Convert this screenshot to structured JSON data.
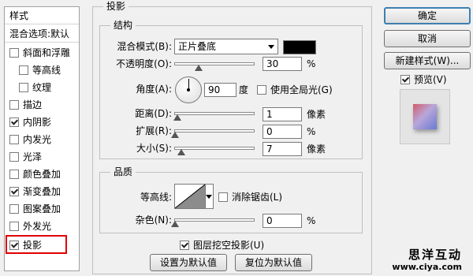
{
  "sidebar": {
    "header": "样式",
    "blend_options": "混合选项:默认",
    "items": [
      {
        "label": "斜面和浮雕",
        "checked": false,
        "sub": false
      },
      {
        "label": "等高线",
        "checked": false,
        "sub": true
      },
      {
        "label": "纹理",
        "checked": false,
        "sub": true
      },
      {
        "label": "描边",
        "checked": false,
        "sub": false
      },
      {
        "label": "内阴影",
        "checked": true,
        "sub": false
      },
      {
        "label": "内发光",
        "checked": false,
        "sub": false
      },
      {
        "label": "光泽",
        "checked": false,
        "sub": false
      },
      {
        "label": "颜色叠加",
        "checked": false,
        "sub": false
      },
      {
        "label": "渐变叠加",
        "checked": true,
        "sub": false
      },
      {
        "label": "图案叠加",
        "checked": false,
        "sub": false
      },
      {
        "label": "外发光",
        "checked": false,
        "sub": false
      },
      {
        "label": "投影",
        "checked": true,
        "sub": false
      }
    ]
  },
  "panel": {
    "title": "投影",
    "structure": {
      "title": "结构",
      "blend_mode_label": "混合模式(B):",
      "blend_mode_value": "正片叠底",
      "shadow_color": "#000000",
      "opacity_label": "不透明度(O):",
      "opacity_value": "30",
      "opacity_unit": "%",
      "opacity_level": 0.3,
      "angle_label": "角度(A):",
      "angle_value": "90",
      "angle_unit": "度",
      "global_light_label": "使用全局光(G)",
      "global_light_checked": false,
      "distance_label": "距离(D):",
      "distance_value": "1",
      "distance_unit": "像素",
      "spread_label": "扩展(R):",
      "spread_value": "0",
      "spread_unit": "%",
      "size_label": "大小(S):",
      "size_value": "7",
      "size_unit": "像素"
    },
    "quality": {
      "title": "品质",
      "contour_label": "等高线:",
      "anti_alias_label": "消除锯齿(L)",
      "anti_alias_checked": false,
      "noise_label": "杂色(N):",
      "noise_value": "0",
      "noise_unit": "%"
    },
    "knockout_label": "图层挖空投影(U)",
    "knockout_checked": true,
    "set_default_label": "设置为默认值",
    "reset_default_label": "复位为默认值"
  },
  "buttons": {
    "ok": "确定",
    "cancel": "取消",
    "new_style": "新建样式(W)...",
    "preview_label": "预览(V)",
    "preview_checked": true
  },
  "watermark": {
    "line1": "思洋互动",
    "line2": "www.ciya.com"
  }
}
